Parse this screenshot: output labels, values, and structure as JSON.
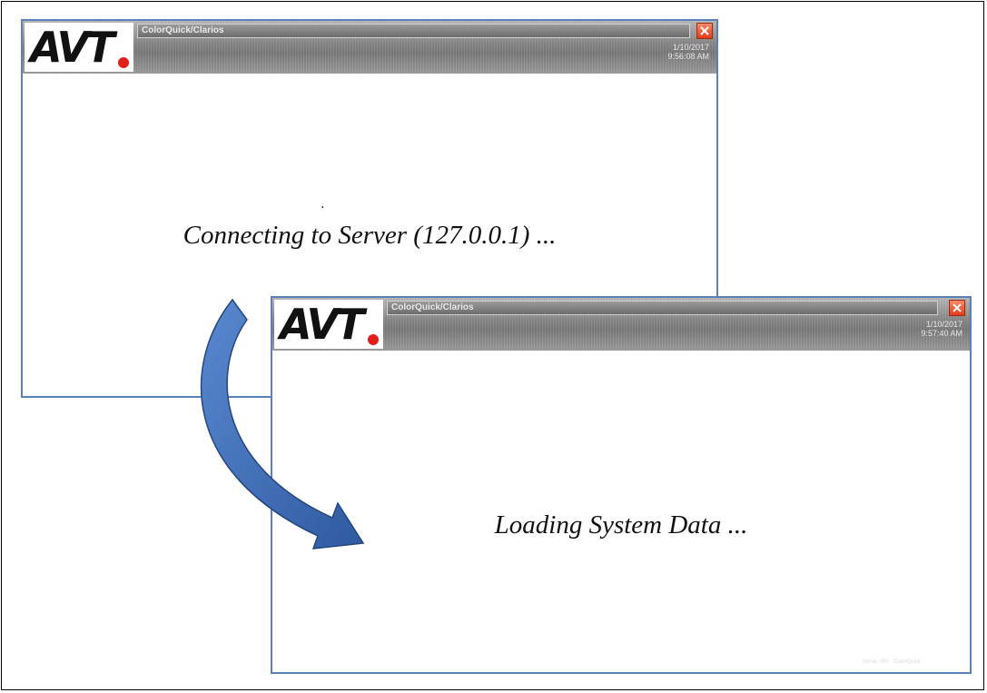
{
  "windows": [
    {
      "title": "ColorQuick/Clarios",
      "logo": "AVT",
      "date": "1/10/2017",
      "time": "9:56:08 AM",
      "status": "Connecting to Server (127.0.0.1) ...",
      "dot": "."
    },
    {
      "title": "ColorQuick/Clarios",
      "logo": "AVT",
      "date": "1/10/2017",
      "time": "9:57:40 AM",
      "status": "Loading System Data ...",
      "watermark": "Serial: 000 · ColorQuick"
    }
  ],
  "icons": {
    "close": "close-x-icon",
    "arrow": "curved-transition-arrow"
  },
  "colors": {
    "window_border": "#5b82b8",
    "arrow_fill": "#3c6ab0",
    "logo_dot": "#e0201b",
    "close_button": "#e23b1a"
  }
}
